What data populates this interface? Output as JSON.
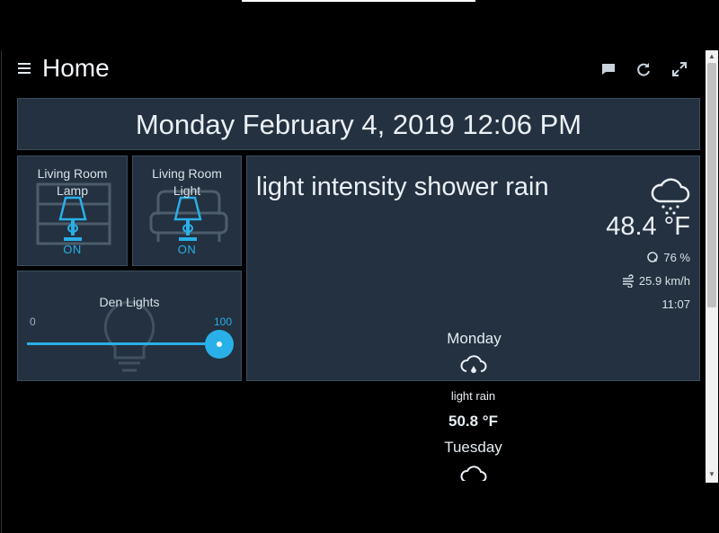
{
  "header": {
    "title": "Home"
  },
  "clock": {
    "text": "Monday February 4, 2019 12:06 PM"
  },
  "switches": [
    {
      "label_line1": "Living Room",
      "label_line2": "Lamp",
      "state": "ON"
    },
    {
      "label_line1": "Living Room",
      "label_line2": "Light",
      "state": "ON"
    }
  ],
  "dimmer": {
    "label": "Den Lights",
    "min": "0",
    "max": "100",
    "level": 100
  },
  "weather": {
    "condition": "light intensity shower rain",
    "temperature": "48.4 °F",
    "humidity": "76 %",
    "wind": "25.9 km/h",
    "time": "11:07"
  },
  "forecast": [
    {
      "day": "Monday",
      "condition": "light rain",
      "temp": "50.8 °F"
    },
    {
      "day": "Tuesday"
    }
  ],
  "colors": {
    "accent": "#2ab0e8",
    "tile": "#233140",
    "background": "#000000"
  }
}
